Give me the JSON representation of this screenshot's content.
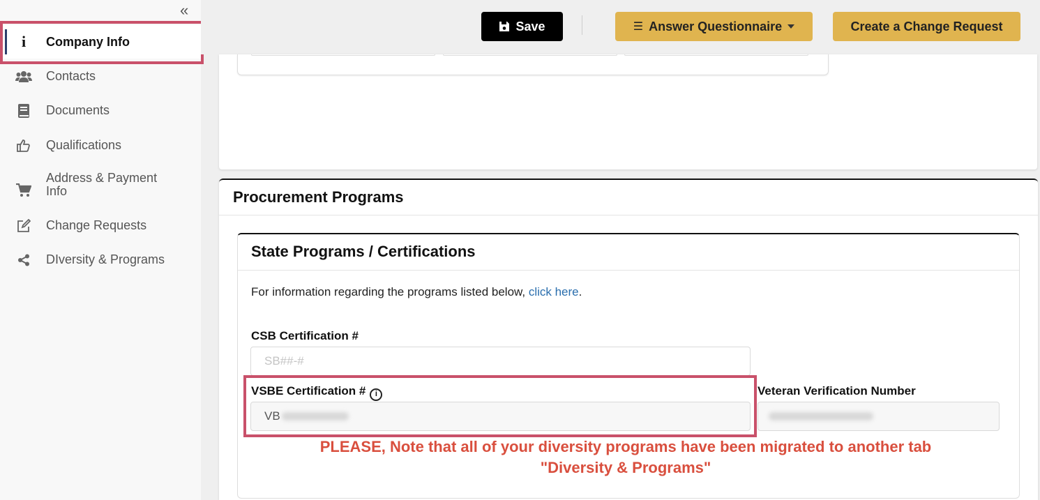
{
  "sidebar": {
    "collapse_icon": "double-chevron-left-icon",
    "items": [
      {
        "label": "Company Info",
        "icon": "info-icon",
        "active": true
      },
      {
        "label": "Contacts",
        "icon": "users-icon"
      },
      {
        "label": "Documents",
        "icon": "book-icon"
      },
      {
        "label": "Qualifications",
        "icon": "thumbs-up-icon"
      },
      {
        "label": "Address & Payment Info",
        "icon": "cart-icon"
      },
      {
        "label": "Change Requests",
        "icon": "edit-icon"
      },
      {
        "label": "DIversity & Programs",
        "icon": "share-icon"
      }
    ]
  },
  "toolbar": {
    "save_label": "Save",
    "questionnaire_label": "Answer Questionnaire",
    "change_request_label": "Create a Change Request"
  },
  "procurement": {
    "title": "Procurement Programs",
    "state_title": "State Programs / Certifications",
    "info_text": "For information regarding the programs listed below, ",
    "info_link": "click here",
    "info_suffix": ".",
    "csb_label": "CSB Certification #",
    "csb_placeholder": "SB##-#",
    "vsbe_label": "VSBE Certification #",
    "vsbe_value": "VB",
    "veteran_label": "Veteran Verification Number",
    "notice_line1": "PLEASE, Note that all of your diversity programs have been migrated to another tab",
    "notice_line2": "\"Diversity & Programs\""
  },
  "colors": {
    "highlight": "#c9516a",
    "accent_button": "#e0b44f",
    "notice": "#d94f3e",
    "link": "#2a6ead"
  }
}
